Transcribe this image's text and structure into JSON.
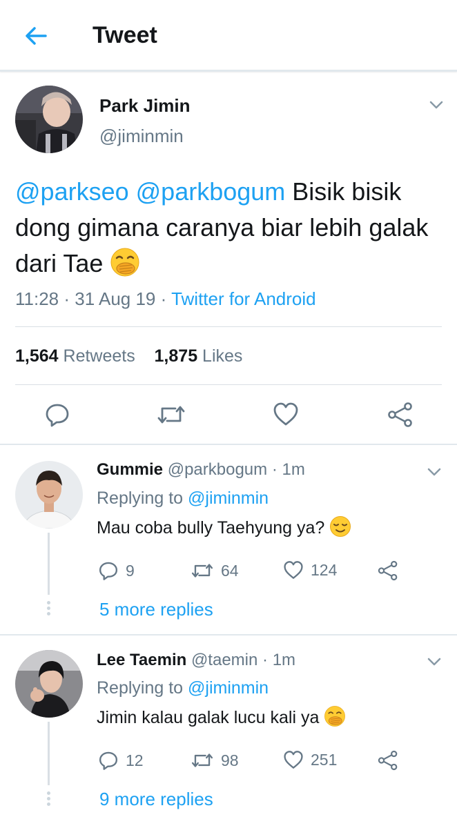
{
  "header": {
    "title": "Tweet",
    "back_icon": "arrow-left-icon",
    "accent": "#1da1f2"
  },
  "tweet": {
    "author_name": "Park Jimin",
    "author_handle": "@jiminmin",
    "mention1": "@parkseo",
    "mention2": "@parkbogum",
    "text_part1": " Bisik bisik dong gimana caranya biar lebih galak dari Tae ",
    "emoji": "face-with-hand-over-mouth",
    "time": "11:28",
    "date": "31 Aug 19",
    "source": "Twitter for Android",
    "sep": "·",
    "retweets_count": "1,564",
    "retweets_label": "Retweets",
    "likes_count": "1,875",
    "likes_label": "Likes"
  },
  "replies": [
    {
      "name": "Gummie",
      "handle": "@parkbogum",
      "time": "1m",
      "replying_prefix": "Replying to",
      "replying_to": "@jiminmin",
      "text": "Mau coba bully Taehyung ya?",
      "emoji": "relieved-face",
      "reply_count": "9",
      "retweet_count": "64",
      "like_count": "124",
      "more_replies": "5 more replies"
    },
    {
      "name": "Lee Taemin",
      "handle": "@taemin",
      "time": "1m",
      "replying_prefix": "Replying to",
      "replying_to": "@jiminmin",
      "text": "Jimin kalau galak lucu kali ya",
      "emoji": "face-with-hand-over-mouth",
      "reply_count": "12",
      "retweet_count": "98",
      "like_count": "251",
      "more_replies": "9 more replies"
    }
  ]
}
